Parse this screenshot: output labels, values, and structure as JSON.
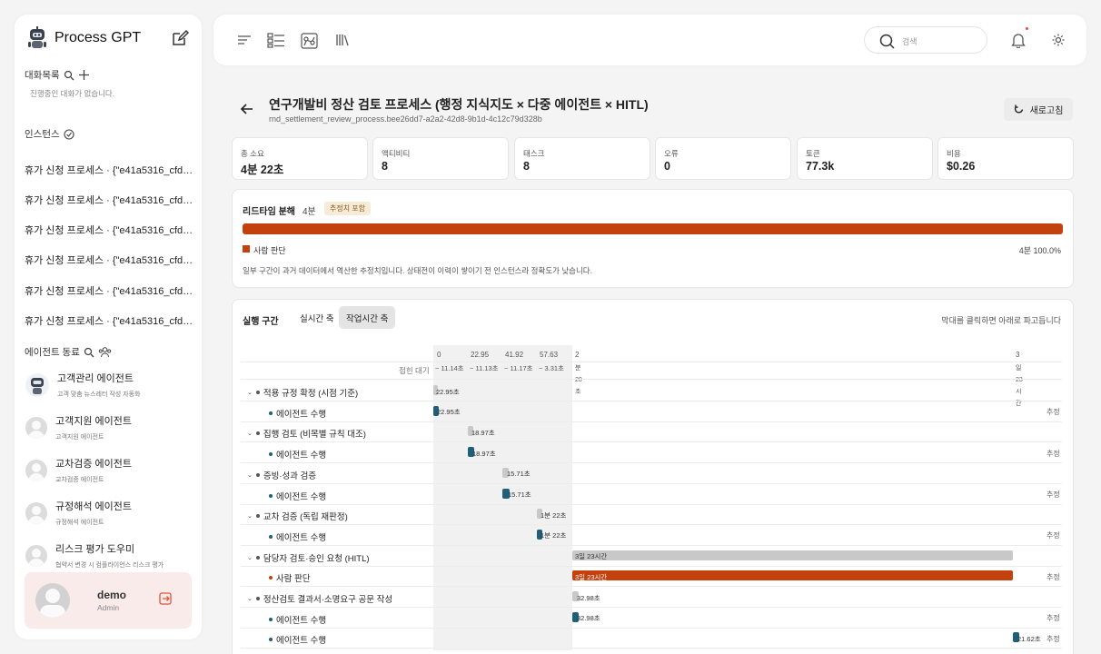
{
  "app": {
    "title": "Process GPT"
  },
  "sidebar": {
    "conversations": {
      "title": "대화목록",
      "empty": "진행중인 대화가 없습니다."
    },
    "instances": {
      "title": "인스턴스",
      "items": [
        "휴가 신청 프로세스 · {\"e41a5316_cfd0...",
        "휴가 신청 프로세스 · {\"e41a5316_cfd0...",
        "휴가 신청 프로세스 · {\"e41a5316_cfd0...",
        "휴가 신청 프로세스 · {\"e41a5316_cfd0...",
        "휴가 신청 프로세스 · {\"e41a5316_cfd0...",
        "휴가 신청 프로세스 · {\"e41a5316_cfd0..."
      ]
    },
    "agents": {
      "title": "에이전트 동료",
      "items": [
        {
          "name": "고객관리 에이전트",
          "desc": "고객 맞춤 뉴스레터 작성 자동화"
        },
        {
          "name": "고객지원 에이전트",
          "desc": "고객지원 에이전트"
        },
        {
          "name": "교차검증 에이전트",
          "desc": "교차검증 에이전트"
        },
        {
          "name": "규정해석 에이전트",
          "desc": "규정해석 에이전트"
        },
        {
          "name": "리스크 평가 도우미",
          "desc": "협약서 변경 시 컴플라이언스 리스크 평가"
        }
      ]
    },
    "user": {
      "name": "demo",
      "role": "Admin"
    }
  },
  "topbar": {
    "search_placeholder": "검색"
  },
  "header": {
    "title": "연구개발비 정산 검토 프로세스 (행정 지식지도 × 다중 에이전트 × HITL)",
    "subtitle": "rnd_settlement_review_process.bee26dd7-a2a2-42d8-9b1d-4c12c79d328b",
    "refresh_label": "새로고침"
  },
  "stats": [
    {
      "label": "총 소요",
      "value": "4분 22초"
    },
    {
      "label": "액티비티",
      "value": "8"
    },
    {
      "label": "태스크",
      "value": "8"
    },
    {
      "label": "오류",
      "value": "0"
    },
    {
      "label": "토큰",
      "value": "77.3k"
    },
    {
      "label": "비용",
      "value": "$0.26"
    }
  ],
  "leadtime": {
    "title": "리드타임 분해",
    "duration": "4분",
    "badge": "추정치 포함",
    "legend": "사람 판단",
    "right": "4분   100.0%",
    "note": "일부 구간이 과거 데이터에서 역산한 추정치입니다. 상태전이 이력이 쌓이기 전 인스턴스라 정확도가 낮습니다.",
    "color": "#c2410c"
  },
  "execution": {
    "title": "실행 구간",
    "tabs": [
      "실시간 축",
      "작업시간 축"
    ],
    "active_tab": 1,
    "hint": "막대를 클릭하면 아래로 파고듭니다",
    "axis_ticks": [
      "0",
      "22.95",
      "41.92",
      "57.63",
      "2",
      "3"
    ],
    "axis_tick_2_sub": [
      "분",
      "20",
      "초"
    ],
    "axis_tick_3_sub": [
      "일",
      "23",
      "시",
      "간"
    ],
    "collapsed_label": "접힌 대기",
    "gaps": [
      "~ 11.14초",
      "~ 11.13초",
      "~ 11.17초",
      "~ 3.31초"
    ],
    "estimate_label": "추정",
    "colors": {
      "agent": "#1f5f7a",
      "human": "#c2410c",
      "group": "#c8c8c8"
    },
    "rows": [
      {
        "kind": "group",
        "name": "적용 규정 확정 (시점 기준)",
        "dot": "#555",
        "label": "22.95초",
        "est": false
      },
      {
        "kind": "task",
        "name": "에이전트 수행",
        "dot": "#1f5f7a",
        "label": "22.95초",
        "est": true
      },
      {
        "kind": "group",
        "name": "집행 검토 (비목별 규칙 대조)",
        "dot": "#555",
        "label": "18.97초",
        "est": false
      },
      {
        "kind": "task",
        "name": "에이전트 수행",
        "dot": "#1f5f7a",
        "label": "18.97초",
        "est": true
      },
      {
        "kind": "group",
        "name": "증빙·성과 검증",
        "dot": "#555",
        "label": "15.71초",
        "est": false
      },
      {
        "kind": "task",
        "name": "에이전트 수행",
        "dot": "#1f5f7a",
        "label": "15.71초",
        "est": true
      },
      {
        "kind": "group",
        "name": "교차 검증 (독립 재판정)",
        "dot": "#555",
        "label": "1분 22초",
        "est": false
      },
      {
        "kind": "task",
        "name": "에이전트 수행",
        "dot": "#1f5f7a",
        "label": "1분 22초",
        "est": true
      },
      {
        "kind": "group",
        "name": "담당자 검토·승인 요청 (HITL)",
        "dot": "#555",
        "label": "3일 23시간",
        "est": false
      },
      {
        "kind": "task",
        "name": "사람 판단",
        "dot": "#c2410c",
        "label": "3일 23시간",
        "est": true
      },
      {
        "kind": "group",
        "name": "정산검토 결과서·소명요구 공문 작성",
        "dot": "#555",
        "label": "32.98초",
        "est": false
      },
      {
        "kind": "task",
        "name": "에이전트 수행",
        "dot": "#1f5f7a",
        "label": "32.98초",
        "est": true
      },
      {
        "kind": "task",
        "name": "에이전트 수행",
        "dot": "#1f5f7a",
        "label": "21.62초",
        "est": true
      }
    ]
  }
}
